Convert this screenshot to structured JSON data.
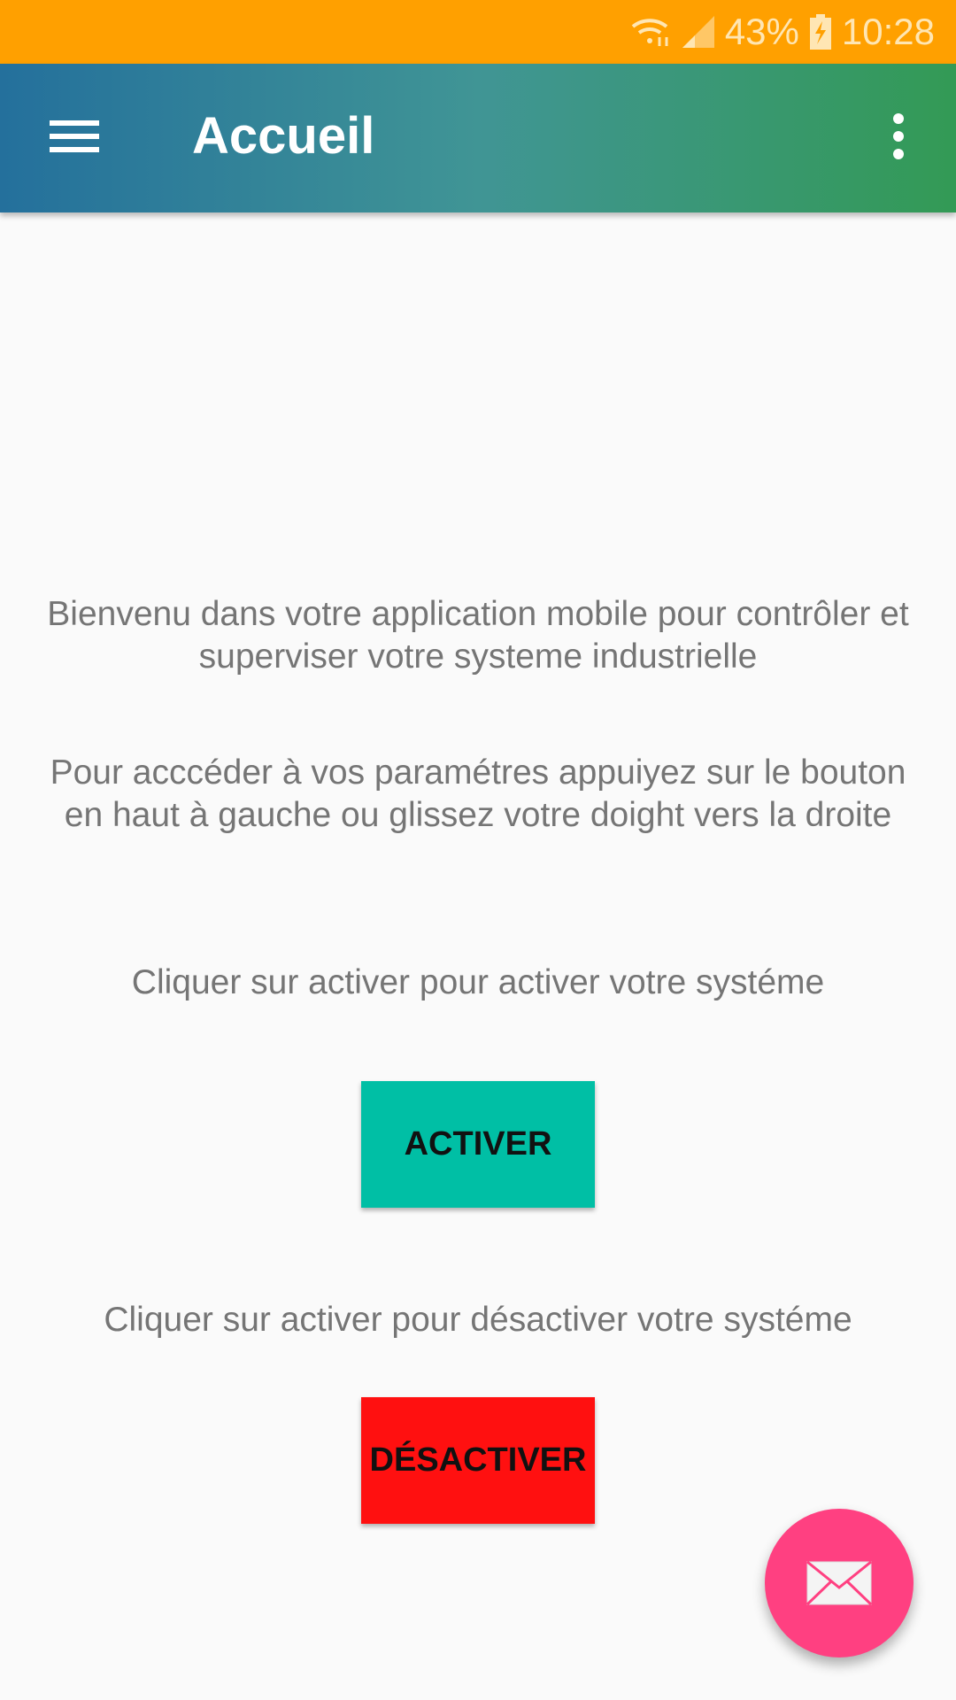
{
  "status_bar": {
    "battery": "43%",
    "time": "10:28"
  },
  "toolbar": {
    "title": "Accueil"
  },
  "main": {
    "welcome_line1": "Bienvenu dans votre application mobile pour contrôler et",
    "welcome_line2": "superviser votre systeme industrielle",
    "hint_line1": "Pour acccéder à vos paramétres appuiyez sur le bouton",
    "hint_line2": "en haut à gauche ou glissez votre doight vers la droite",
    "activate_text": "Cliquer sur activer pour activer votre systéme",
    "activate_label": "ACTIVER",
    "deactivate_text": "Cliquer sur activer pour désactiver votre systéme",
    "deactivate_label": "DÉSACTIVER"
  },
  "colors": {
    "status": "#ffa000",
    "activate": "#00bfa5",
    "deactivate": "#ff1010",
    "fab": "#ff4081"
  }
}
